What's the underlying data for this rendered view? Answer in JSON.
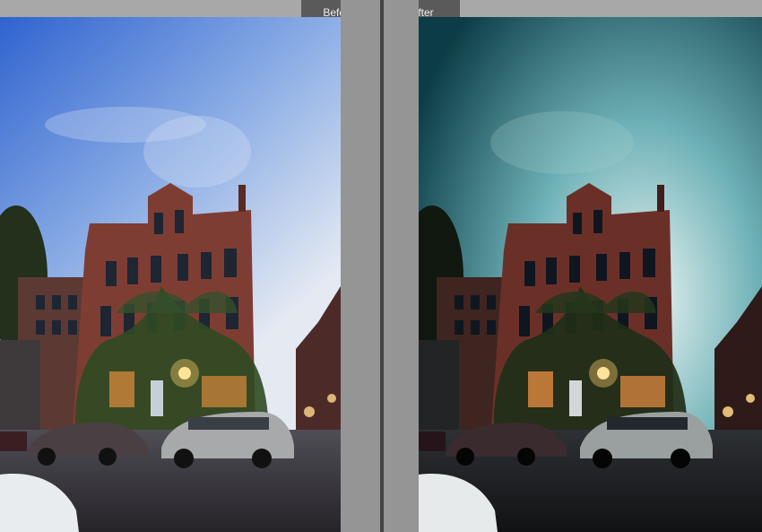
{
  "compare_view": {
    "before_label": "Before",
    "after_label": "After"
  },
  "colors": {
    "before_sky_top": "#3d6fd6",
    "before_sky_bottom": "#dfe6f3",
    "after_sky_top": "#0f4a54",
    "after_sky_bottom": "#e9f1ee",
    "brick": "#7b3b32",
    "ivy": "#2f4a22",
    "lights": "#ffcf6a"
  }
}
